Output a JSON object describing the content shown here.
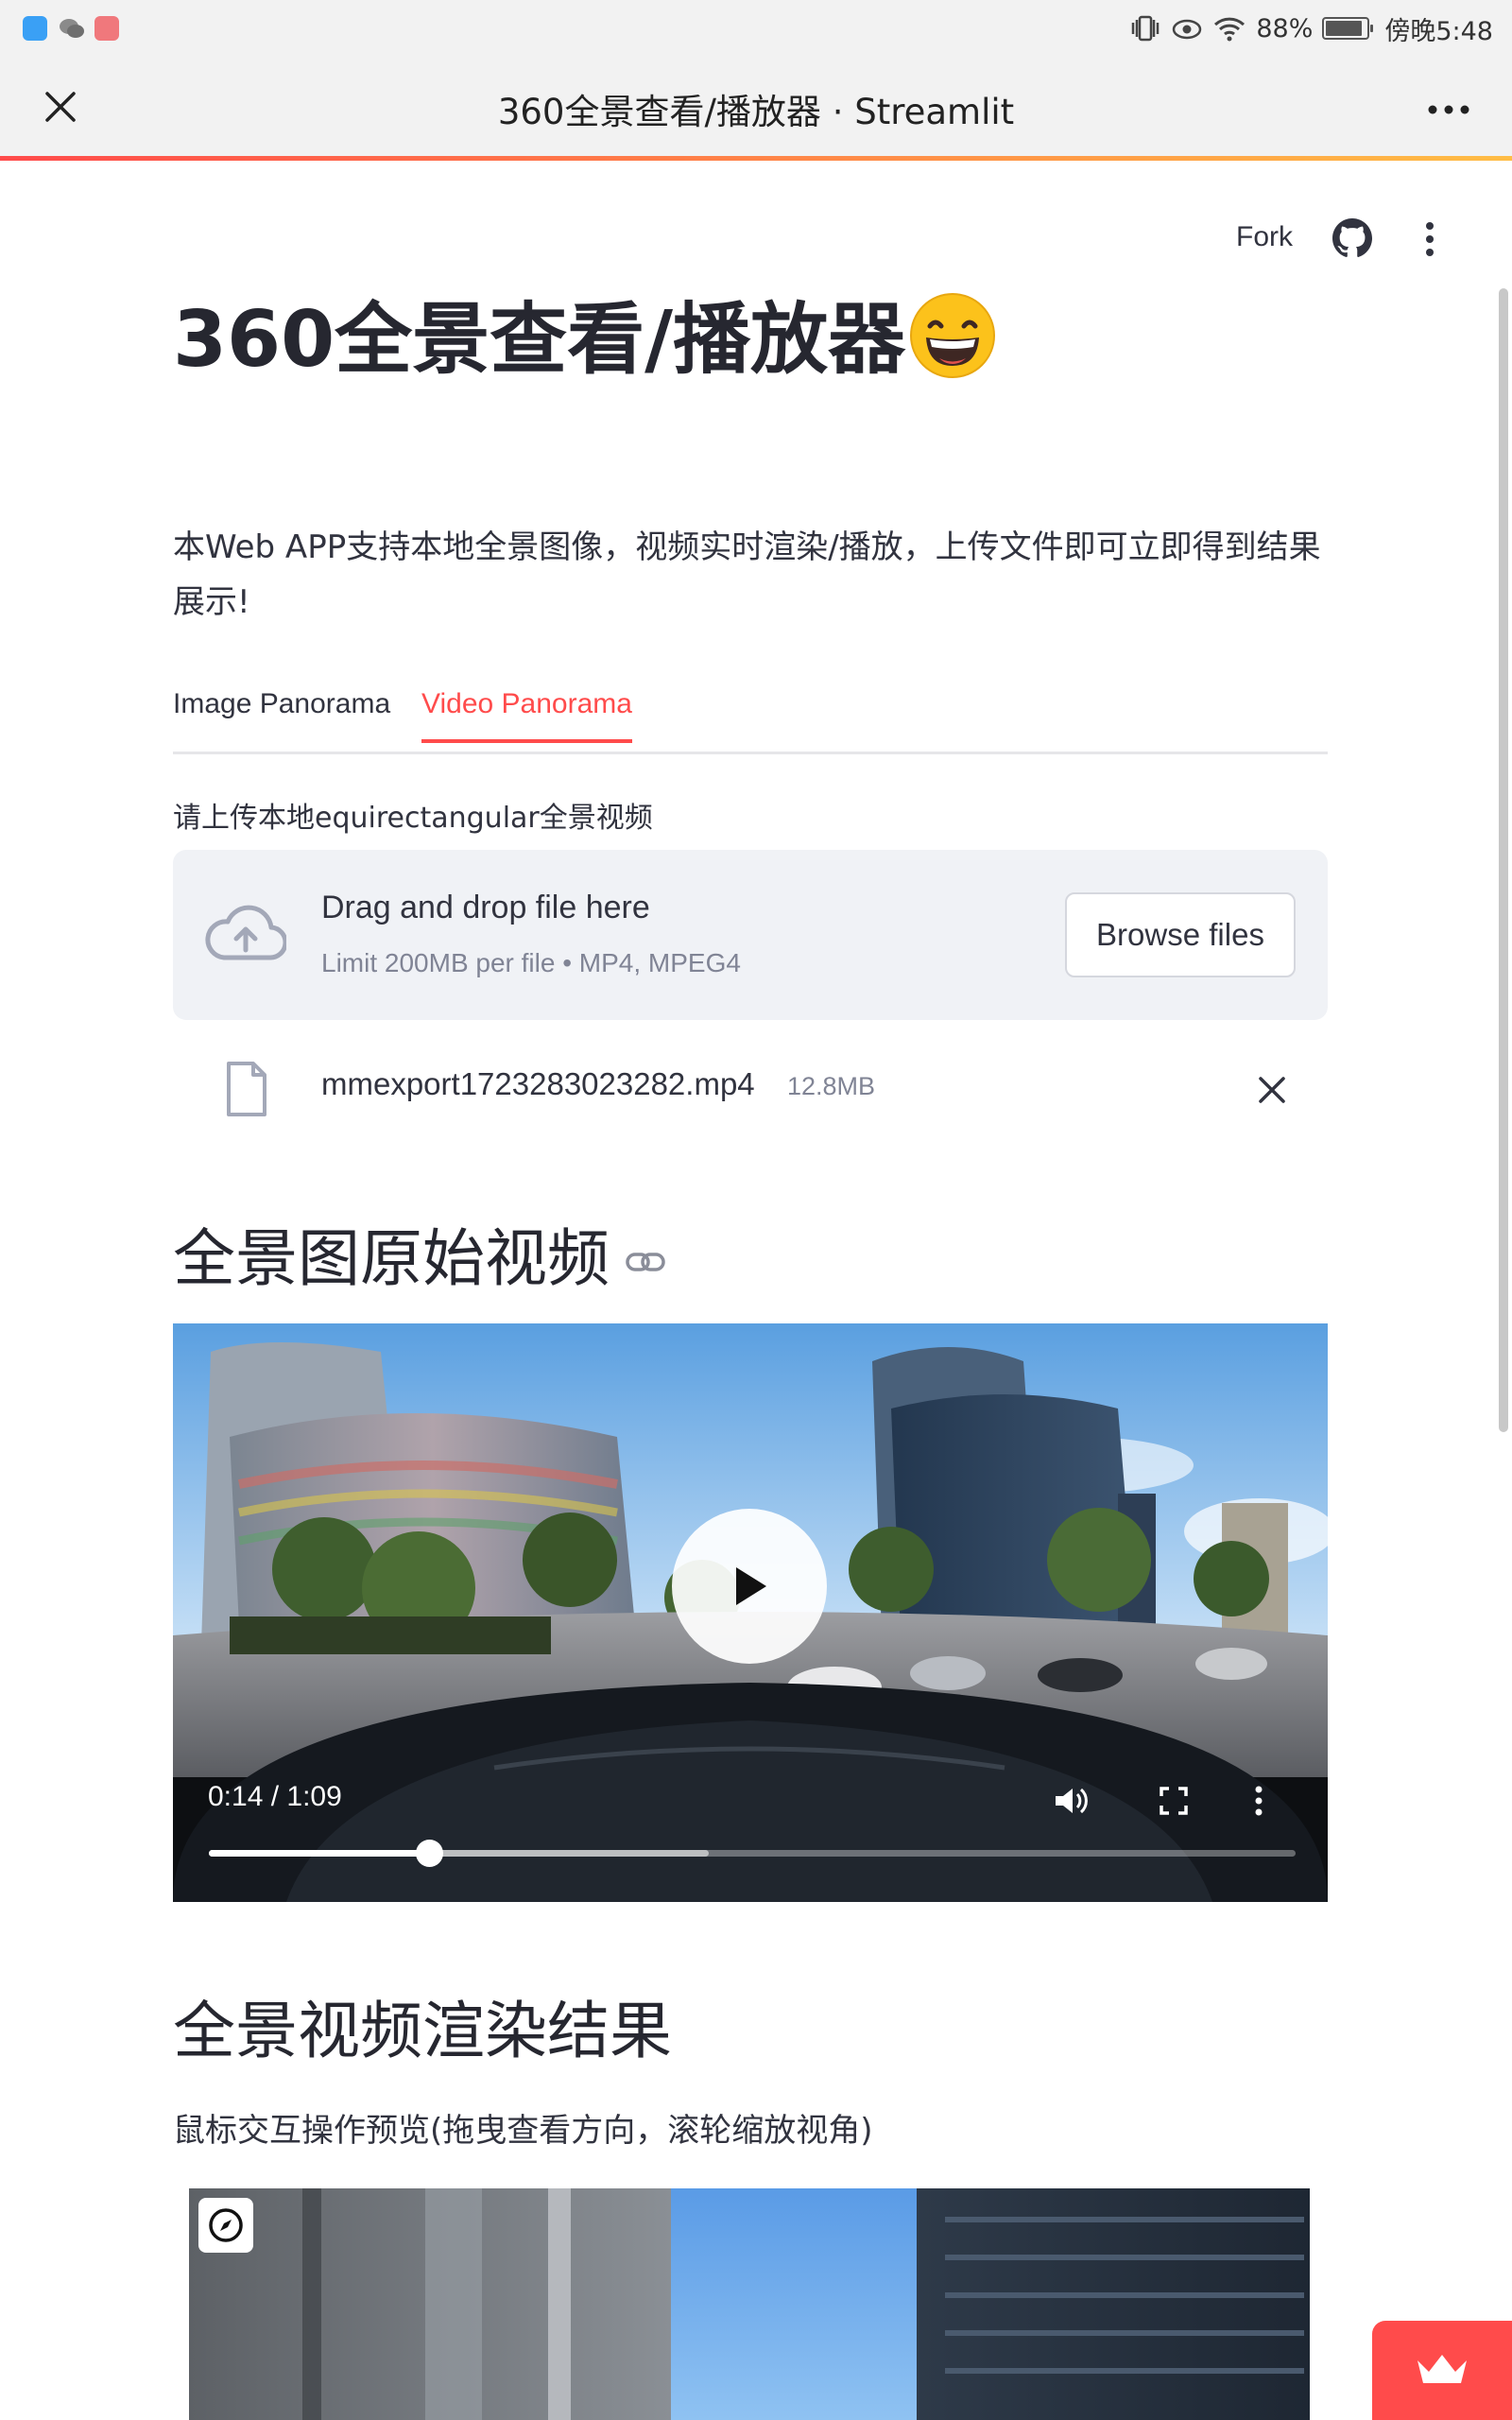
{
  "status_bar": {
    "battery": "88%",
    "time": "傍晚5:48"
  },
  "browser": {
    "title": "360全景查看/播放器 · Streamlit"
  },
  "header": {
    "fork_label": "Fork"
  },
  "page": {
    "title": "360全景查看/播放器",
    "title_emoji": "grinning-face-emoji",
    "intro": "本Web APP支持本地全景图像，视频实时渲染/播放，上传文件即可立即得到结果展示!"
  },
  "tabs": [
    {
      "label": "Image Panorama",
      "active": false
    },
    {
      "label": "Video Panorama",
      "active": true
    }
  ],
  "uploader": {
    "label": "请上传本地equirectangular全景视频",
    "drop_title": "Drag and drop file here",
    "limit_text": "Limit 200MB per file • MP4, MPEG4",
    "browse_label": "Browse files"
  },
  "uploaded_file": {
    "name": "mmexport1723283023282.mp4",
    "size": "12.8MB"
  },
  "section_video": {
    "heading": "全景图原始视频"
  },
  "video_player": {
    "time": "0:14 / 1:09",
    "progress_fraction": 0.203,
    "buffered_fraction": 0.46
  },
  "section_render": {
    "heading": "全景视频渲染结果",
    "subtitle": "鼠标交互操作预览(拖曳查看方向，滚轮缩放视角)"
  },
  "colors": {
    "accent": "#ff4b4b",
    "text": "#31333f",
    "muted": "#808495",
    "dropzone_bg": "#f0f2f6"
  }
}
